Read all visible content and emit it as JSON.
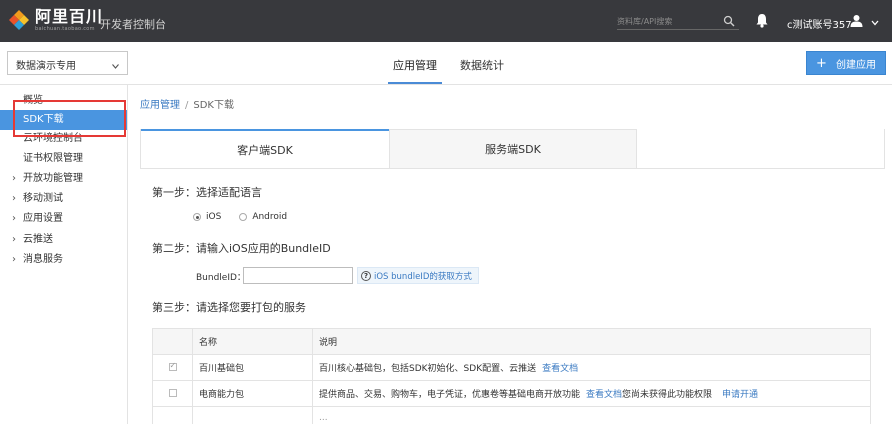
{
  "topbar": {
    "logo_cn": "阿里百川",
    "logo_en": "baichuan.taobao.com",
    "console_title": "开发者控制台",
    "search_placeholder": "资料库/API搜索",
    "account_name": "c测试账号357"
  },
  "subheader": {
    "app_select_value": "数据演示专用",
    "tabs": [
      {
        "label": "应用管理",
        "active": true
      },
      {
        "label": "数据统计",
        "active": false
      }
    ],
    "create_button": "创建应用"
  },
  "sidebar": {
    "items": [
      {
        "label": "概览",
        "type": "child",
        "active": false
      },
      {
        "label": "SDK下载",
        "type": "child",
        "active": true
      },
      {
        "label": "云环境控制台",
        "type": "child",
        "active": false
      },
      {
        "label": "证书权限管理",
        "type": "child",
        "active": false
      },
      {
        "label": "开放功能管理",
        "type": "parent",
        "active": false
      },
      {
        "label": "移动测试",
        "type": "parent",
        "active": false
      },
      {
        "label": "应用设置",
        "type": "parent",
        "active": false
      },
      {
        "label": "云推送",
        "type": "parent",
        "active": false
      },
      {
        "label": "消息服务",
        "type": "parent",
        "active": false
      }
    ]
  },
  "breadcrumb": {
    "parent": "应用管理",
    "separator": "/",
    "current": "SDK下载"
  },
  "sdk_tabs": [
    {
      "label": "客户端SDK",
      "active": true
    },
    {
      "label": "服务端SDK",
      "active": false
    }
  ],
  "step1": {
    "title": "第一步：选择适配语言",
    "options": [
      {
        "label": "iOS",
        "selected": true
      },
      {
        "label": "Android",
        "selected": false
      }
    ]
  },
  "step2": {
    "title": "第二步：请输入iOS应用的BundleID",
    "field_label": "BundleID：",
    "field_value": "",
    "help_link": "iOS bundleID的获取方式"
  },
  "step3": {
    "title": "第三步：请选择您要打包的服务",
    "columns": [
      "",
      "名称",
      "说明"
    ],
    "rows": [
      {
        "checked": true,
        "name": "百川基础包",
        "desc": "百川核心基础包，包括SDK初始化、SDK配置、云推送",
        "link": "查看文档",
        "note": "",
        "extra_link": ""
      },
      {
        "checked": false,
        "name": "电商能力包",
        "desc": "提供商品、交易、购物车，电子凭证，优惠卷等基础电商开放功能",
        "link": "查看文档",
        "note": "您尚未获得此功能权限",
        "extra_link": "申请开通"
      }
    ],
    "partial_row_text": "..."
  },
  "colors": {
    "topbar_bg": "#38393d",
    "accent": "#4a95e0",
    "link": "#3a7ac2",
    "highlight": "#e53935"
  }
}
